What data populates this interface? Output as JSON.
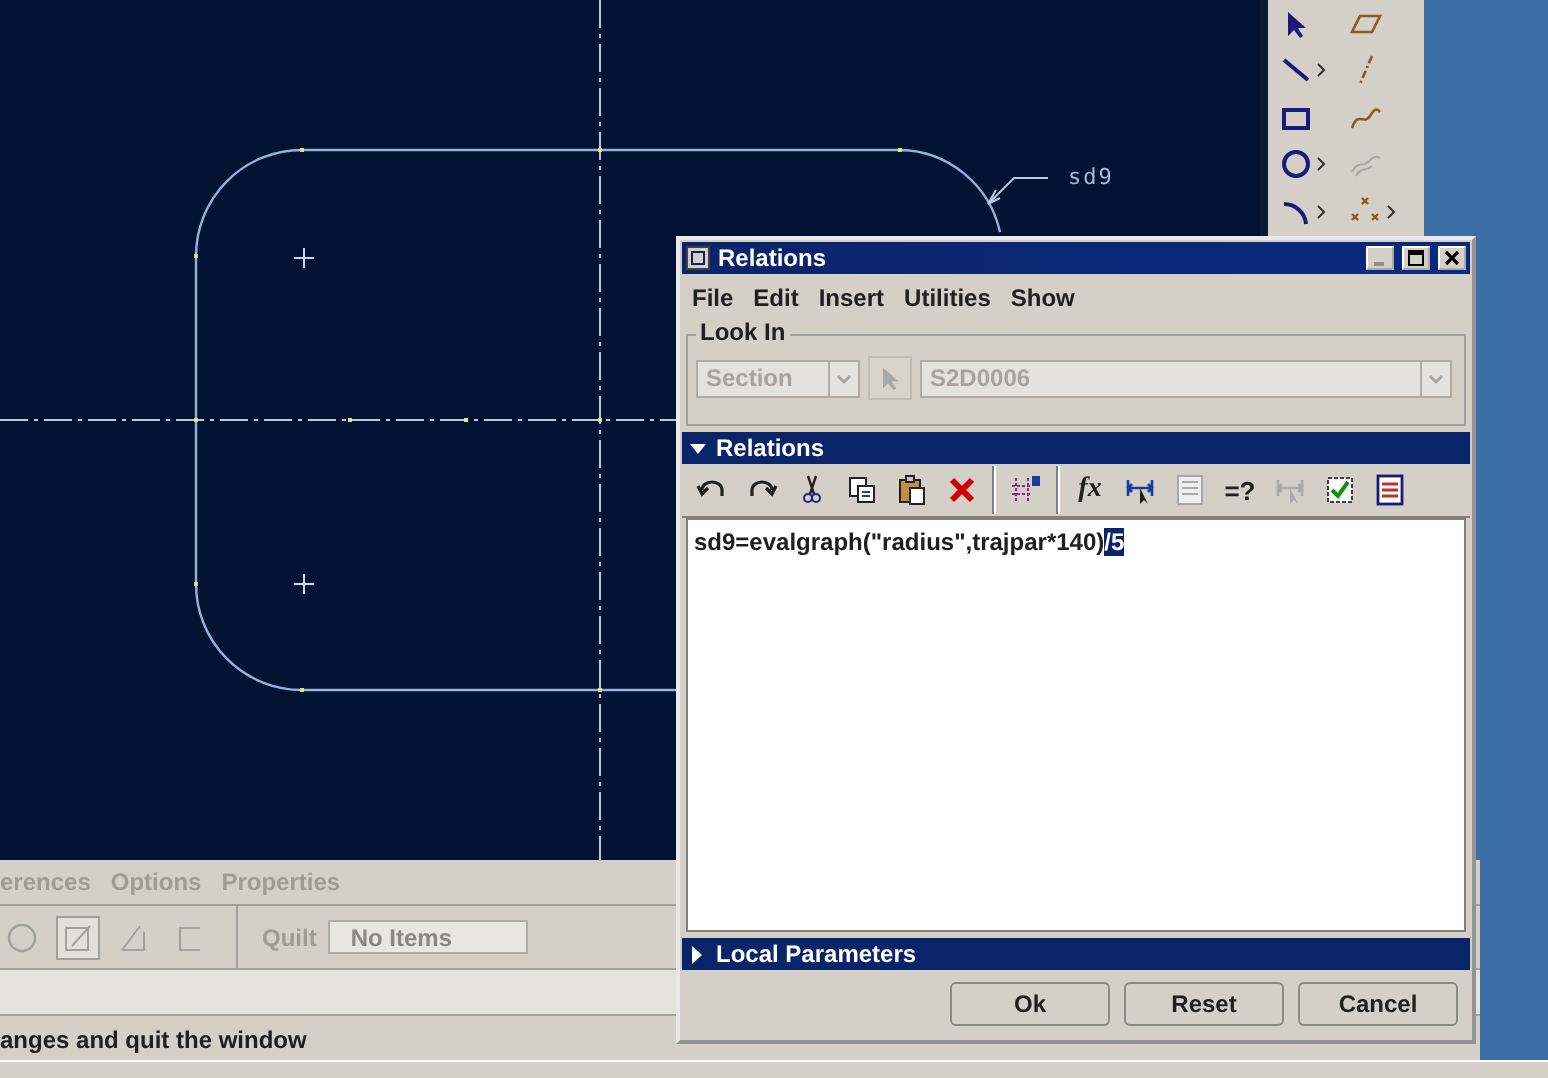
{
  "canvas": {
    "dimension_label": "sd9"
  },
  "sketch_palette": [
    {
      "kind": "select",
      "disabled": false,
      "flyout": false
    },
    {
      "kind": "parallelogram",
      "disabled": false,
      "flyout": false
    },
    {
      "kind": "line",
      "disabled": false,
      "flyout": true
    },
    {
      "kind": "centerline",
      "disabled": false,
      "flyout": false
    },
    {
      "kind": "rectangle",
      "disabled": false,
      "flyout": false
    },
    {
      "kind": "spline",
      "disabled": false,
      "flyout": false
    },
    {
      "kind": "circle",
      "disabled": false,
      "flyout": true
    },
    {
      "kind": "blend",
      "disabled": true,
      "flyout": false
    },
    {
      "kind": "arc",
      "disabled": false,
      "flyout": true
    },
    {
      "kind": "points",
      "disabled": false,
      "flyout": true
    }
  ],
  "main_window": {
    "tabs": [
      {
        "label": "erences",
        "disabled": true
      },
      {
        "label": "Options",
        "disabled": true
      },
      {
        "label": "Properties",
        "disabled": true
      }
    ],
    "toolbar": [
      {
        "kind": "zoom",
        "pressed": false
      },
      {
        "kind": "sketch",
        "pressed": true
      },
      {
        "kind": "plane",
        "pressed": false
      },
      {
        "kind": "bracket",
        "pressed": false
      }
    ],
    "quilt": {
      "label": "Quilt",
      "value": "No Items"
    },
    "status": "anges and quit the window"
  },
  "dialog": {
    "title": "Relations",
    "menu": [
      "File",
      "Edit",
      "Insert",
      "Utilities",
      "Show"
    ],
    "look_in": {
      "label": "Look In",
      "type_select": {
        "value": "Section",
        "disabled": true
      },
      "object_select": {
        "value": "S2D0006",
        "disabled": true
      }
    },
    "sections": [
      {
        "kind": "relations",
        "title": "Relations",
        "expanded": true
      },
      {
        "kind": "local_parameters",
        "title": "Local Parameters",
        "expanded": false
      }
    ],
    "toolbar": [
      {
        "kind": "undo",
        "disabled": false
      },
      {
        "kind": "redo",
        "disabled": false
      },
      {
        "kind": "cut",
        "disabled": false
      },
      {
        "kind": "copy",
        "disabled": false
      },
      {
        "kind": "paste",
        "disabled": false
      },
      {
        "kind": "delete",
        "disabled": false
      },
      {
        "kind": "separator"
      },
      {
        "kind": "units",
        "disabled": false
      },
      {
        "kind": "separator"
      },
      {
        "kind": "text",
        "label": "fx",
        "disabled": false
      },
      {
        "kind": "dimension",
        "disabled": false
      },
      {
        "kind": "table",
        "disabled": true
      },
      {
        "kind": "text",
        "label": "=?",
        "disabled": false
      },
      {
        "kind": "dimension",
        "disabled": true
      },
      {
        "kind": "verify",
        "disabled": false
      },
      {
        "kind": "sort",
        "disabled": false
      }
    ],
    "editor": {
      "text": "sd9=evalgraph(\"radius\",trajpar*140)",
      "selection": "/5"
    },
    "buttons": [
      {
        "label": "Ok"
      },
      {
        "label": "Reset"
      },
      {
        "label": "Cancel"
      }
    ]
  }
}
